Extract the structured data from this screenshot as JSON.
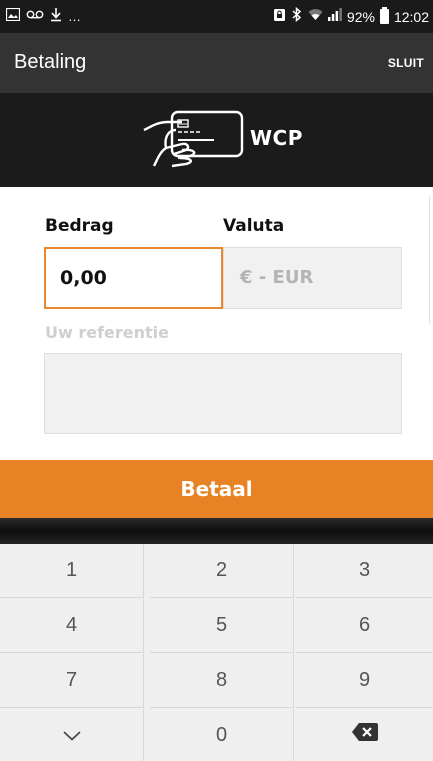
{
  "status_bar": {
    "left_icons": [
      "image-icon",
      "voicemail-icon",
      "download-icon"
    ],
    "ellipsis": "…",
    "battery_percent": "92%",
    "time": "12:02"
  },
  "app_bar": {
    "title": "Betaling",
    "close_label": "SLUIT"
  },
  "banner": {
    "brand_name": "WCP",
    "logo_icon": "card-payment-hand-icon"
  },
  "form": {
    "amount_label": "Bedrag",
    "amount_value": "0,00",
    "currency_label": "Valuta",
    "currency_value": "€ - EUR",
    "reference_label": "Uw referentie",
    "reference_value": ""
  },
  "pay_button": {
    "label": "Betaal"
  },
  "keypad": {
    "keys": [
      "1",
      "2",
      "3",
      "4",
      "5",
      "6",
      "7",
      "8",
      "9",
      "⌄",
      "0",
      "⌫"
    ]
  },
  "colors": {
    "accent": "#e88325",
    "app_bar": "#333333",
    "banner": "#1b1b1b",
    "status_bar": "#1a1a1a"
  }
}
